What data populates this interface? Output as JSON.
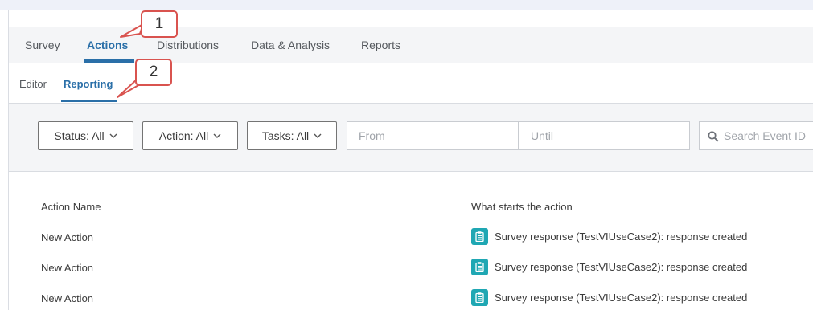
{
  "nav": {
    "tabs": [
      {
        "label": "Survey"
      },
      {
        "label": "Actions"
      },
      {
        "label": "Distributions"
      },
      {
        "label": "Data & Analysis"
      },
      {
        "label": "Reports"
      }
    ],
    "active_tab": "Actions"
  },
  "subnav": {
    "tabs": [
      {
        "label": "Editor"
      },
      {
        "label": "Reporting"
      }
    ],
    "active_tab": "Reporting"
  },
  "filters": {
    "status": "Status: All",
    "action": "Action: All",
    "tasks": "Tasks: All",
    "from_placeholder": "From",
    "until_placeholder": "Until",
    "search_placeholder": "Search Event ID"
  },
  "table": {
    "columns": [
      "Action Name",
      "What starts the action"
    ],
    "rows": [
      {
        "name": "New Action",
        "trigger": "Survey response (TestVIUseCase2): response created"
      },
      {
        "name": "New Action",
        "trigger": "Survey response (TestVIUseCase2): response created"
      },
      {
        "name": "New Action",
        "trigger": "Survey response (TestVIUseCase2): response created"
      }
    ]
  },
  "annotations": [
    "1",
    "2"
  ],
  "colors": {
    "accent": "#2a6fa8",
    "trigger_badge": "#1fa7b3",
    "callout_border": "#d9534f"
  },
  "icons": {
    "chevron": "chevron-down-icon",
    "search": "search-icon",
    "trigger": "survey-response-icon"
  }
}
